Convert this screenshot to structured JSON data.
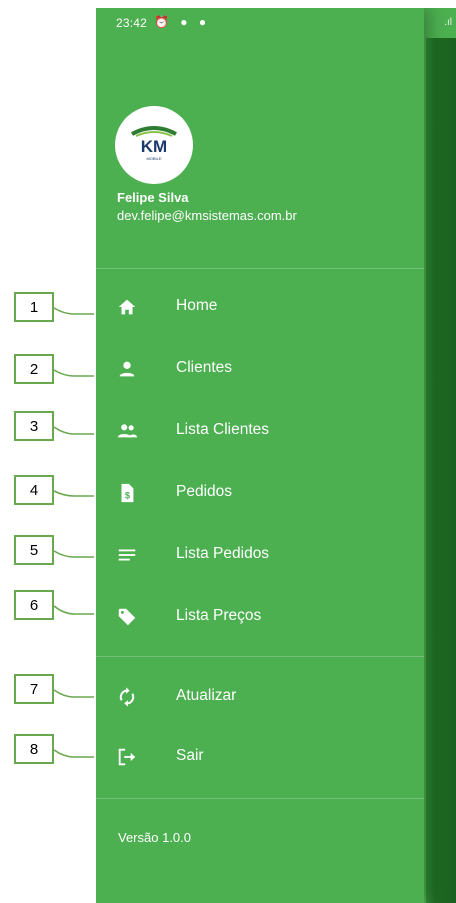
{
  "status_bar": {
    "time": "23:42",
    "icons": "⏰ ● ●",
    "signal": ".ıl"
  },
  "user": {
    "name": "Felipe Silva",
    "email": "dev.felipe@kmsistemas.com.br",
    "logo_text": "KM",
    "logo_subtext": "MOBILE"
  },
  "menu": [
    {
      "label": "Home",
      "icon": "home-icon"
    },
    {
      "label": "Clientes",
      "icon": "person-icon"
    },
    {
      "label": "Lista Clientes",
      "icon": "people-icon"
    },
    {
      "label": "Pedidos",
      "icon": "invoice-icon"
    },
    {
      "label": "Lista Pedidos",
      "icon": "list-icon"
    },
    {
      "label": "Lista Preços",
      "icon": "tag-icon"
    },
    {
      "label": "Atualizar",
      "icon": "sync-icon"
    },
    {
      "label": "Sair",
      "icon": "logout-icon"
    }
  ],
  "version": "Versão 1.0.0",
  "callouts": [
    "1",
    "2",
    "3",
    "4",
    "5",
    "6",
    "7",
    "8"
  ],
  "colors": {
    "drawer_bg": "#4caf50",
    "callout_border": "#6aa84f",
    "text": "#ffffff"
  }
}
